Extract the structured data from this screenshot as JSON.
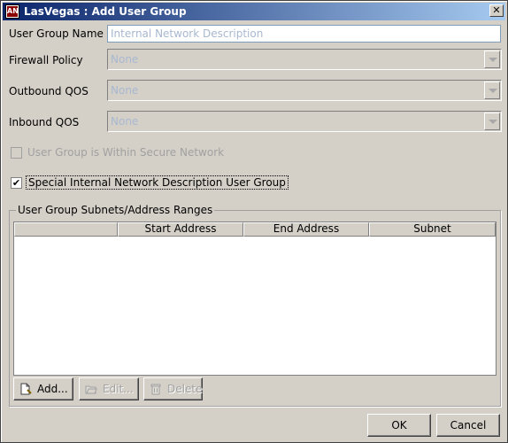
{
  "window": {
    "title": "LasVegas : Add User Group",
    "icon_letters": "AN",
    "close_glyph": "✕"
  },
  "form": {
    "user_group_name_label": "User Group Name",
    "user_group_name_value": "Internal Network Description",
    "firewall_policy_label": "Firewall Policy",
    "firewall_policy_value": "None",
    "outbound_qos_label": "Outbound QOS",
    "outbound_qos_value": "None",
    "inbound_qos_label": "Inbound QOS",
    "inbound_qos_value": "None",
    "secure_network_label": "User Group is Within Secure Network",
    "secure_network_checked": false,
    "special_internal_label": "Special Internal Network Description User Group",
    "special_internal_checked": true,
    "check_glyph": "✔"
  },
  "subnets": {
    "group_title": "User Group Subnets/Address Ranges",
    "columns": [
      "",
      "Start Address",
      "End Address",
      "Subnet"
    ],
    "rows": []
  },
  "buttons": {
    "add": "Add...",
    "edit": "Edit...",
    "delete": "Delete",
    "ok": "OK",
    "cancel": "Cancel"
  },
  "colors": {
    "titlebar_start": "#0a246a",
    "titlebar_end": "#a6caf0",
    "dialog_bg": "#d4d0c8",
    "disabled_text": "#a8b8d0"
  },
  "icons": {
    "title": "app-logo-icon",
    "add": "new-document-icon",
    "edit": "open-folder-icon",
    "delete": "trash-can-icon",
    "combo_arrow": "chevron-down-icon",
    "checkmark": "checkmark-icon"
  }
}
